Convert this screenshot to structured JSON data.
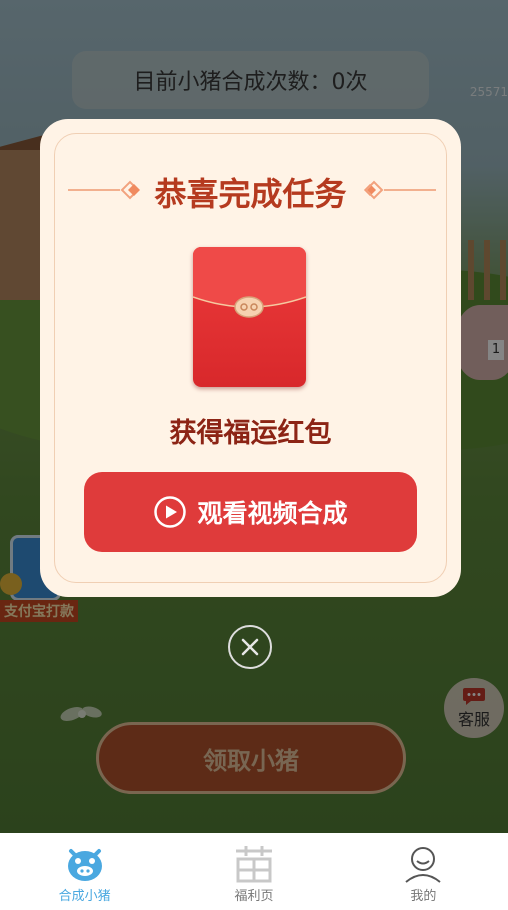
{
  "background": {
    "counter_text": "目前小猪合成次数：0次",
    "corner_id": "25571",
    "pig_tag": "1",
    "alipay_label": "支付宝打款",
    "claim_button": "领取小猪",
    "service_label": "客服"
  },
  "modal": {
    "title": "恭喜完成任务",
    "reward_text": "获得福运红包",
    "watch_button": "观看视频合成"
  },
  "tabs": [
    {
      "label": "合成小猪",
      "icon": "pig-icon",
      "active": true
    },
    {
      "label": "福利页",
      "icon": "welfare-icon",
      "active": false
    },
    {
      "label": "我的",
      "icon": "user-icon",
      "active": false
    }
  ],
  "colors": {
    "accent_red": "#df3b3b",
    "title_red": "#b53a1f",
    "active_tab": "#4aa8e0"
  }
}
